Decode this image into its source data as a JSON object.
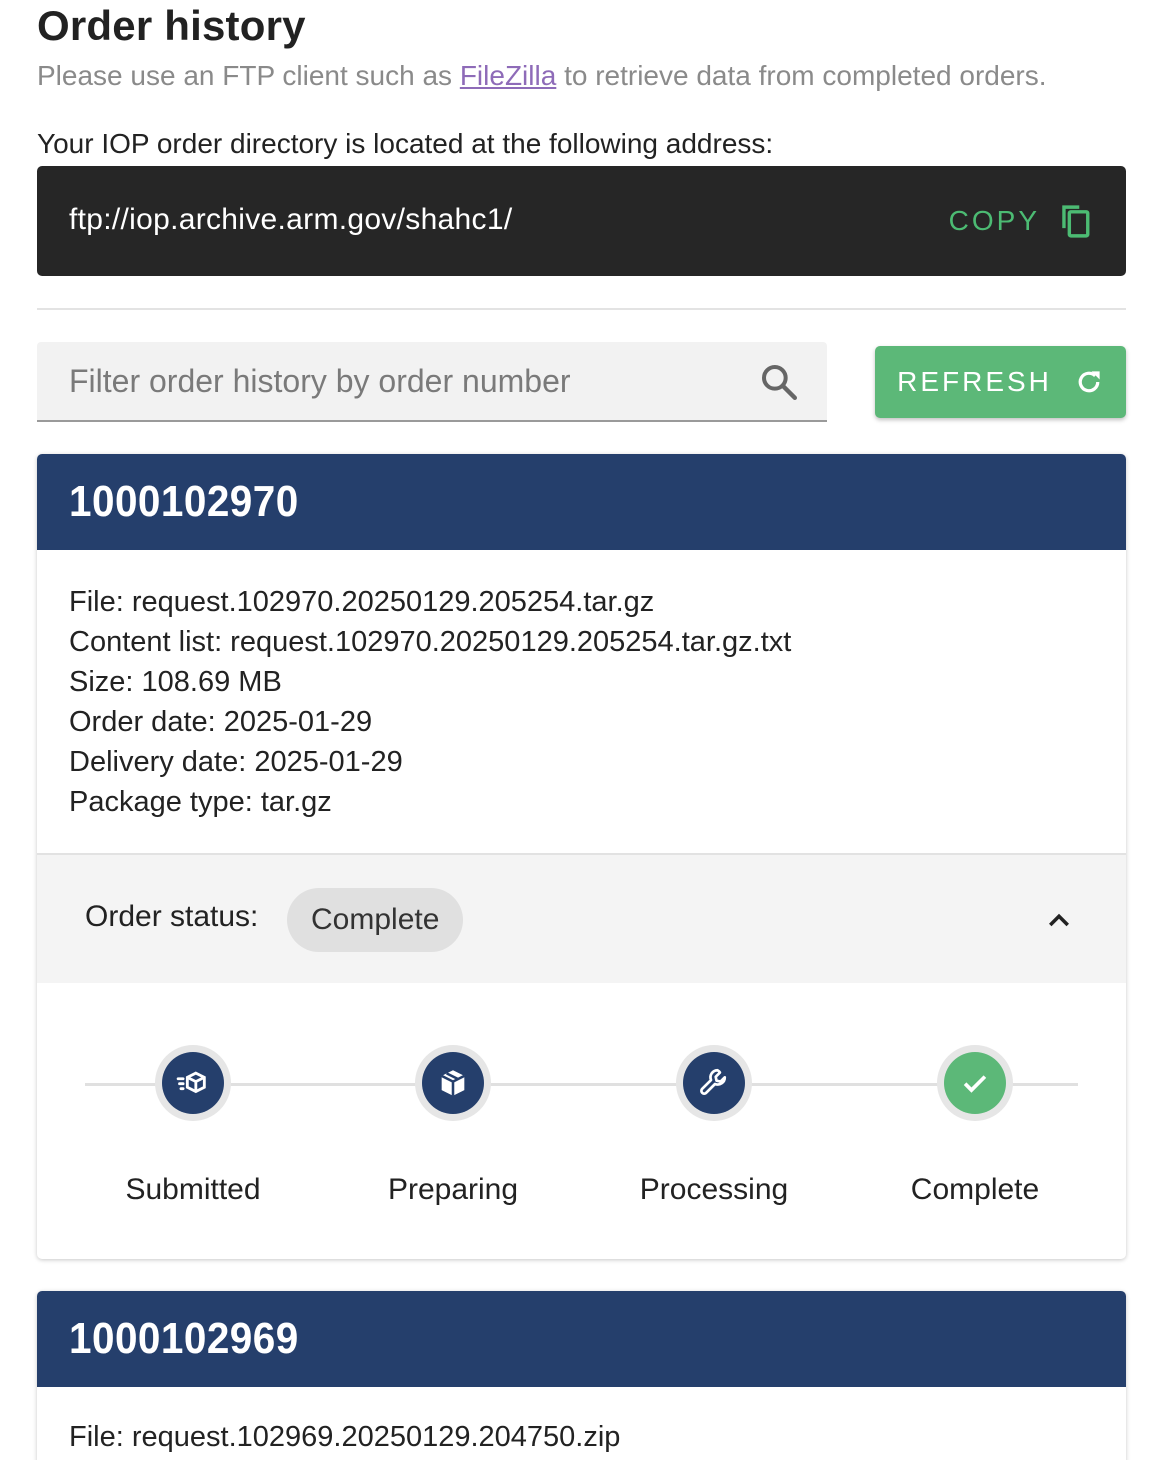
{
  "header": {
    "title": "Order history",
    "subtitle_before": "Please use an FTP client such as ",
    "subtitle_link": "FileZilla",
    "subtitle_after": " to retrieve data from completed orders.",
    "directory_label": "Your IOP order directory is located at the following address:"
  },
  "ftp": {
    "url": "ftp://iop.archive.arm.gov/shahc1/",
    "copy_label": "COPY"
  },
  "filter": {
    "placeholder": "Filter order history by order number",
    "value": ""
  },
  "refresh_label": "REFRESH",
  "colors": {
    "navy": "#253f6c",
    "green": "#5cb878",
    "dark_box": "#262626",
    "link": "#8e6bb8"
  },
  "orders": [
    {
      "number": "1000102970",
      "file": "File: request.102970.20250129.205254.tar.gz",
      "content_list": "Content list: request.102970.20250129.205254.tar.gz.txt",
      "size": "Size: 108.69 MB",
      "order_date": "Order date: 2025-01-29",
      "delivery_date": "Delivery date: 2025-01-29",
      "package_type": "Package type: tar.gz",
      "status_label": "Order status:",
      "status": "Complete",
      "steps": [
        {
          "label": "Submitted",
          "icon": "submitted-box-icon"
        },
        {
          "label": "Preparing",
          "icon": "package-icon"
        },
        {
          "label": "Processing",
          "icon": "wrench-icon"
        },
        {
          "label": "Complete",
          "icon": "check-icon"
        }
      ]
    },
    {
      "number": "1000102969",
      "file": "File: request.102969.20250129.204750.zip"
    }
  ]
}
